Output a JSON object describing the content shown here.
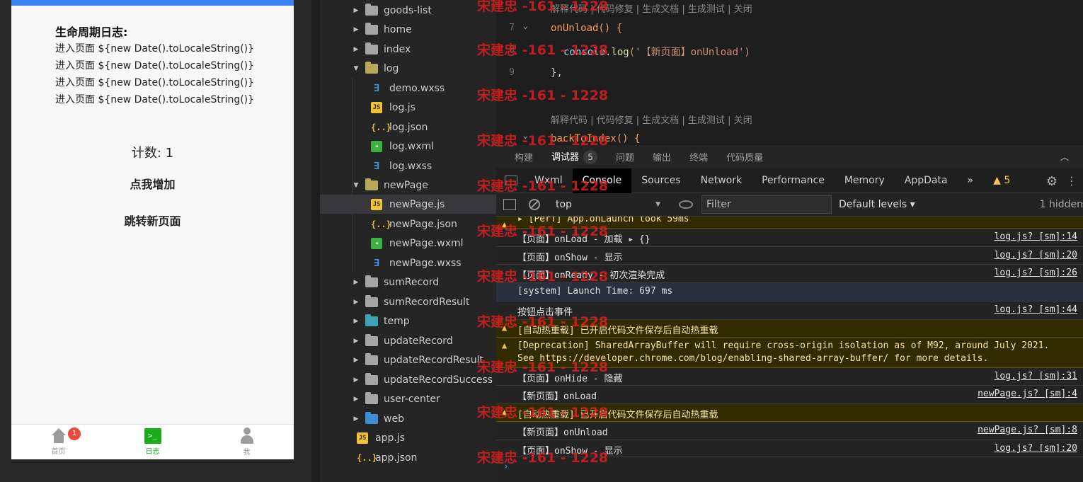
{
  "simulator": {
    "log_title": "生命周期日志:",
    "log_lines": [
      "进入页面 ${new Date().toLocaleString()}",
      "进入页面 ${new Date().toLocaleString()}",
      "进入页面 ${new Date().toLocaleString()}",
      "进入页面 ${new Date().toLocaleString()}"
    ],
    "count_text": "计数: 1",
    "increment_button": "点我增加",
    "jump_button": "跳转新页面",
    "tabbar": [
      {
        "label": "首页",
        "icon": "home-icon",
        "badge": "1"
      },
      {
        "label": "日志",
        "icon": "terminal-icon",
        "active": true
      },
      {
        "label": "我",
        "icon": "user-icon"
      }
    ]
  },
  "file_tree": [
    {
      "name": "goods-list",
      "type": "folder",
      "state": "collapsed"
    },
    {
      "name": "home",
      "type": "folder",
      "state": "collapsed"
    },
    {
      "name": "index",
      "type": "folder",
      "state": "collapsed"
    },
    {
      "name": "log",
      "type": "folder",
      "state": "expanded"
    },
    {
      "name": "demo.wxss",
      "type": "wxss"
    },
    {
      "name": "log.js",
      "type": "js"
    },
    {
      "name": "log.json",
      "type": "json"
    },
    {
      "name": "log.wxml",
      "type": "wxml"
    },
    {
      "name": "log.wxss",
      "type": "wxss"
    },
    {
      "name": "newPage",
      "type": "folder",
      "state": "expanded"
    },
    {
      "name": "newPage.js",
      "type": "js",
      "selected": true
    },
    {
      "name": "newPage.json",
      "type": "json"
    },
    {
      "name": "newPage.wxml",
      "type": "wxml"
    },
    {
      "name": "newPage.wxss",
      "type": "wxss"
    },
    {
      "name": "sumRecord",
      "type": "folder",
      "state": "collapsed"
    },
    {
      "name": "sumRecordResult",
      "type": "folder",
      "state": "collapsed"
    },
    {
      "name": "temp",
      "type": "folder-temp",
      "state": "collapsed"
    },
    {
      "name": "updateRecord",
      "type": "folder",
      "state": "collapsed"
    },
    {
      "name": "updateRecordResult",
      "type": "folder",
      "state": "collapsed"
    },
    {
      "name": "updateRecordSuccess",
      "type": "folder",
      "state": "collapsed"
    },
    {
      "name": "user-center",
      "type": "folder",
      "state": "collapsed"
    },
    {
      "name": "web",
      "type": "folder-web",
      "state": "collapsed"
    },
    {
      "name": "app.js",
      "type": "js"
    },
    {
      "name": "app.json",
      "type": "json"
    }
  ],
  "editor": {
    "codelens_1": "解释代码 | 代码修复 | 生成文档 | 生成测试 | 关闭",
    "codelens_2": "解释代码 | 代码修复 | 生成文档 | 生成测试 | 关闭",
    "line_7": "7",
    "line_8": "8",
    "line_9": "9",
    "code_onunload": "onUnload() {",
    "code_console_pre": "console.",
    "code_console_fn": "log",
    "code_console_str": "('【新页面】onUnload')",
    "code_close": "},",
    "code_backtoindex": "backToIndex() {"
  },
  "panel_tabs": {
    "build": "构建",
    "debugger": "调试器",
    "debugger_count": "5",
    "issues": "问题",
    "output": "输出",
    "terminal": "终端",
    "quality": "代码质量"
  },
  "devtools_tabs": {
    "wxml": "Wxml",
    "console": "Console",
    "sources": "Sources",
    "network": "Network",
    "performance": "Performance",
    "memory": "Memory",
    "appdata": "AppData",
    "more": "»",
    "warnings": "5"
  },
  "console_toolbar": {
    "context": "top",
    "filter_placeholder": "Filter",
    "levels": "Default levels",
    "hidden": "1 hidden"
  },
  "console_rows": [
    {
      "kind": "warn",
      "text": "▸ [Perf] App.onLaunch took 59ms",
      "src": ""
    },
    {
      "kind": "log",
      "text": "【页面】onLoad - 加载 ▸ {}",
      "src": "log.js? [sm]:14"
    },
    {
      "kind": "log",
      "text": "【页面】onShow - 显示",
      "src": "log.js? [sm]:20"
    },
    {
      "kind": "log",
      "text": "【页面】onReady - 初次渲染完成",
      "src": "log.js? [sm]:26"
    },
    {
      "kind": "system",
      "text": "[system] Launch Time: 697 ms",
      "src": ""
    },
    {
      "kind": "log",
      "text": "按钮点击事件",
      "src": "log.js? [sm]:44"
    },
    {
      "kind": "warn",
      "text": "[自动热重载] 已开启代码文件保存后自动热重载",
      "src": ""
    },
    {
      "kind": "warn",
      "text": "[Deprecation] SharedArrayBuffer will require cross-origin isolation as of M92, around July 2021.",
      "text2": "See https://developer.chrome.com/blog/enabling-shared-array-buffer/ for more details.",
      "src": ""
    },
    {
      "kind": "log",
      "text": "【页面】onHide - 隐藏",
      "src": "log.js? [sm]:31"
    },
    {
      "kind": "log",
      "text": "【新页面】onLoad",
      "src": "newPage.js? [sm]:4"
    },
    {
      "kind": "warn",
      "text": "[自动热重载] 已开启代码文件保存后自动热重载",
      "src": ""
    },
    {
      "kind": "log",
      "text": "【新页面】onUnload",
      "src": "newPage.js? [sm]:8"
    },
    {
      "kind": "log",
      "text": "【页面】onShow - 显示",
      "src": "log.js? [sm]:20"
    }
  ],
  "console_prompt": "›",
  "watermark": "宋建忠 -161 - 1228"
}
